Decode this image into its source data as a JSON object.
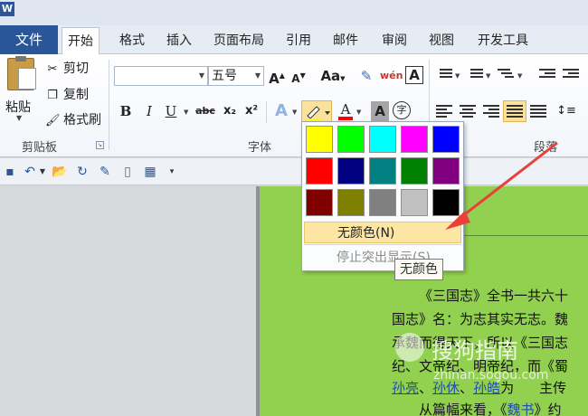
{
  "app": {
    "logo_text": "W"
  },
  "tabs": {
    "file": "文件",
    "items": [
      "开始",
      "格式",
      "插入",
      "页面布局",
      "引用",
      "邮件",
      "审阅",
      "视图",
      "开发工具"
    ]
  },
  "clipboard": {
    "paste": "粘贴",
    "cut": "剪切",
    "copy": "复制",
    "format_painter": "格式刷",
    "group_label": "剪贴板"
  },
  "font": {
    "font_name_value": "",
    "font_size_value": "五号",
    "group_label": "字体",
    "grow": "A",
    "shrink": "A",
    "change_case": "Aa",
    "clear_format": "✎",
    "phonetic": "wén",
    "border_char": "A",
    "bold": "B",
    "italic": "I",
    "underline": "U",
    "strike": "abc",
    "subscript": "x₂",
    "superscript": "x²",
    "text_effect": "A",
    "font_color": "A",
    "char_shading": "A",
    "enclose": "字"
  },
  "paragraph": {
    "group_label": "段落"
  },
  "highlight_dropdown": {
    "colors": [
      [
        "#ffff00",
        "#00ff00",
        "#00ffff",
        "#ff00ff",
        "#0000ff"
      ],
      [
        "#ff0000",
        "#000080",
        "#008080",
        "#008000",
        "#800080"
      ],
      [
        "#800000",
        "#808000",
        "#808080",
        "#c0c0c0",
        "#000000"
      ]
    ],
    "no_color": "无颜色(N)",
    "stop_highlight": "停止突出显示(S)",
    "tooltip": "无颜色"
  },
  "colors": {
    "page_bg": "#92d050",
    "highlight_button": "#fbe29c",
    "font_color_bar": "#ff0000",
    "arrow": "#e8413a",
    "file_tab": "#2a5699"
  },
  "document": {
    "lines": [
      "《三国志》全书一共六十",
      "国志》名：为志其实无志。魏",
      "承魏而得天下，所以《三国志",
      "纪、文帝纪、明帝纪，而《蜀"
    ],
    "line5": [
      "孙亮",
      "、",
      "孙休",
      "、",
      "孙皓",
      "为"
    ],
    "line5_tail": "主传",
    "line6_prefix": "从篇幅来看，《",
    "line6_link": "魏书",
    "line6_suffix": "》约"
  },
  "watermark": {
    "text": "搜狗指南",
    "sub": "zhinan.sogou.com"
  }
}
